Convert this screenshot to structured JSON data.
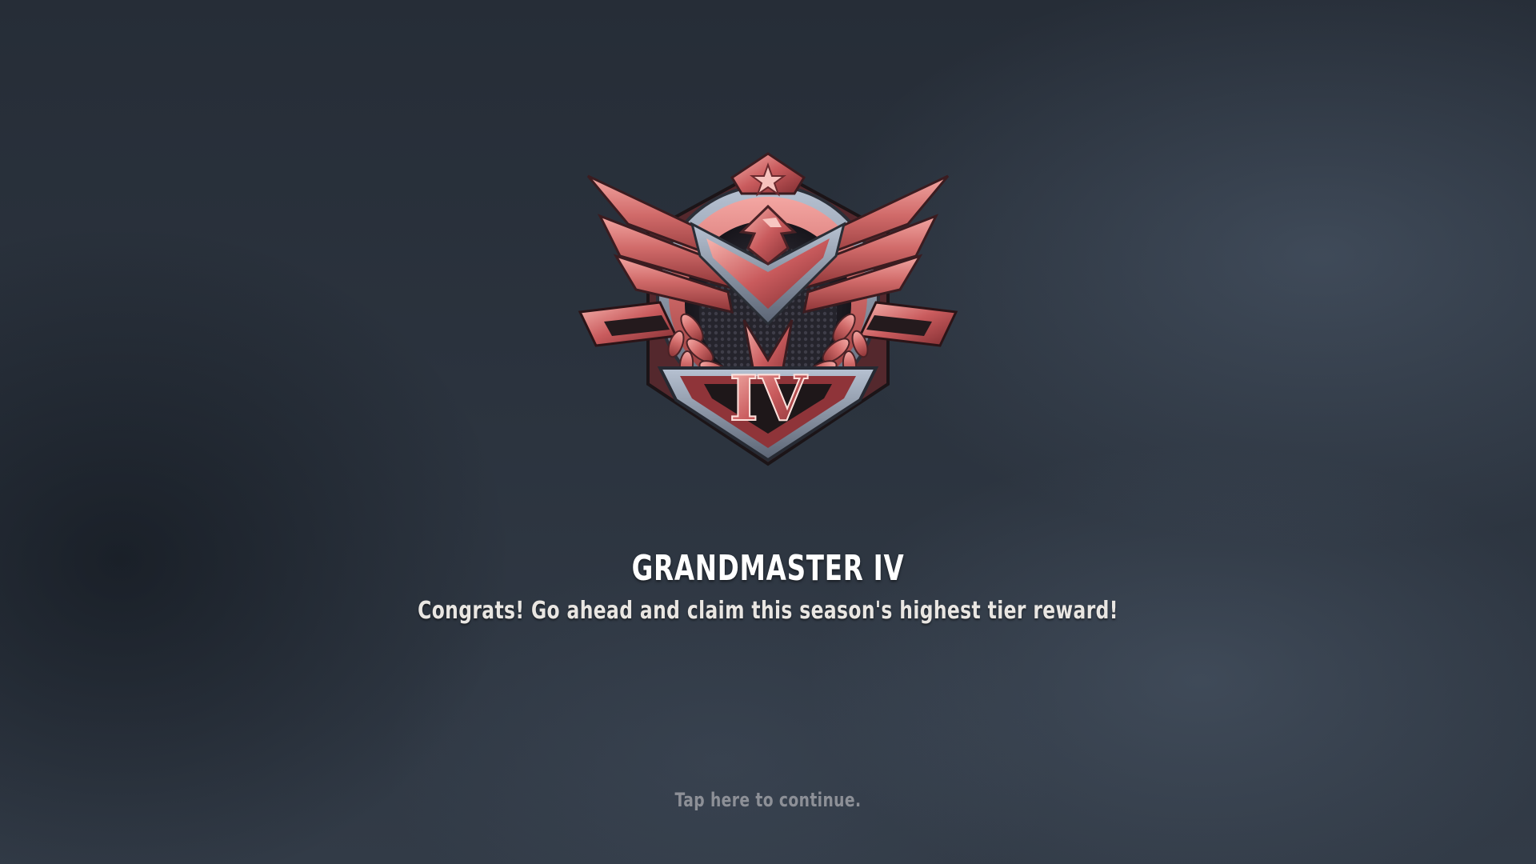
{
  "rank": {
    "title": "GRANDMASTER IV",
    "tier_numeral": "IV",
    "message": "Congrats! Go ahead and claim this season's highest tier reward!"
  },
  "prompt": {
    "continue_label": "Tap here to continue."
  },
  "icons": {
    "emblem": "grandmaster-rank-emblem-icon",
    "star": "star-icon",
    "eagle": "eagle-icon"
  },
  "colors": {
    "emblem_primary": "#c85a5c",
    "emblem_highlight": "#f0a3a0",
    "emblem_dark": "#2a2125",
    "text_primary": "#ffffff",
    "text_muted": "#8d9097"
  }
}
